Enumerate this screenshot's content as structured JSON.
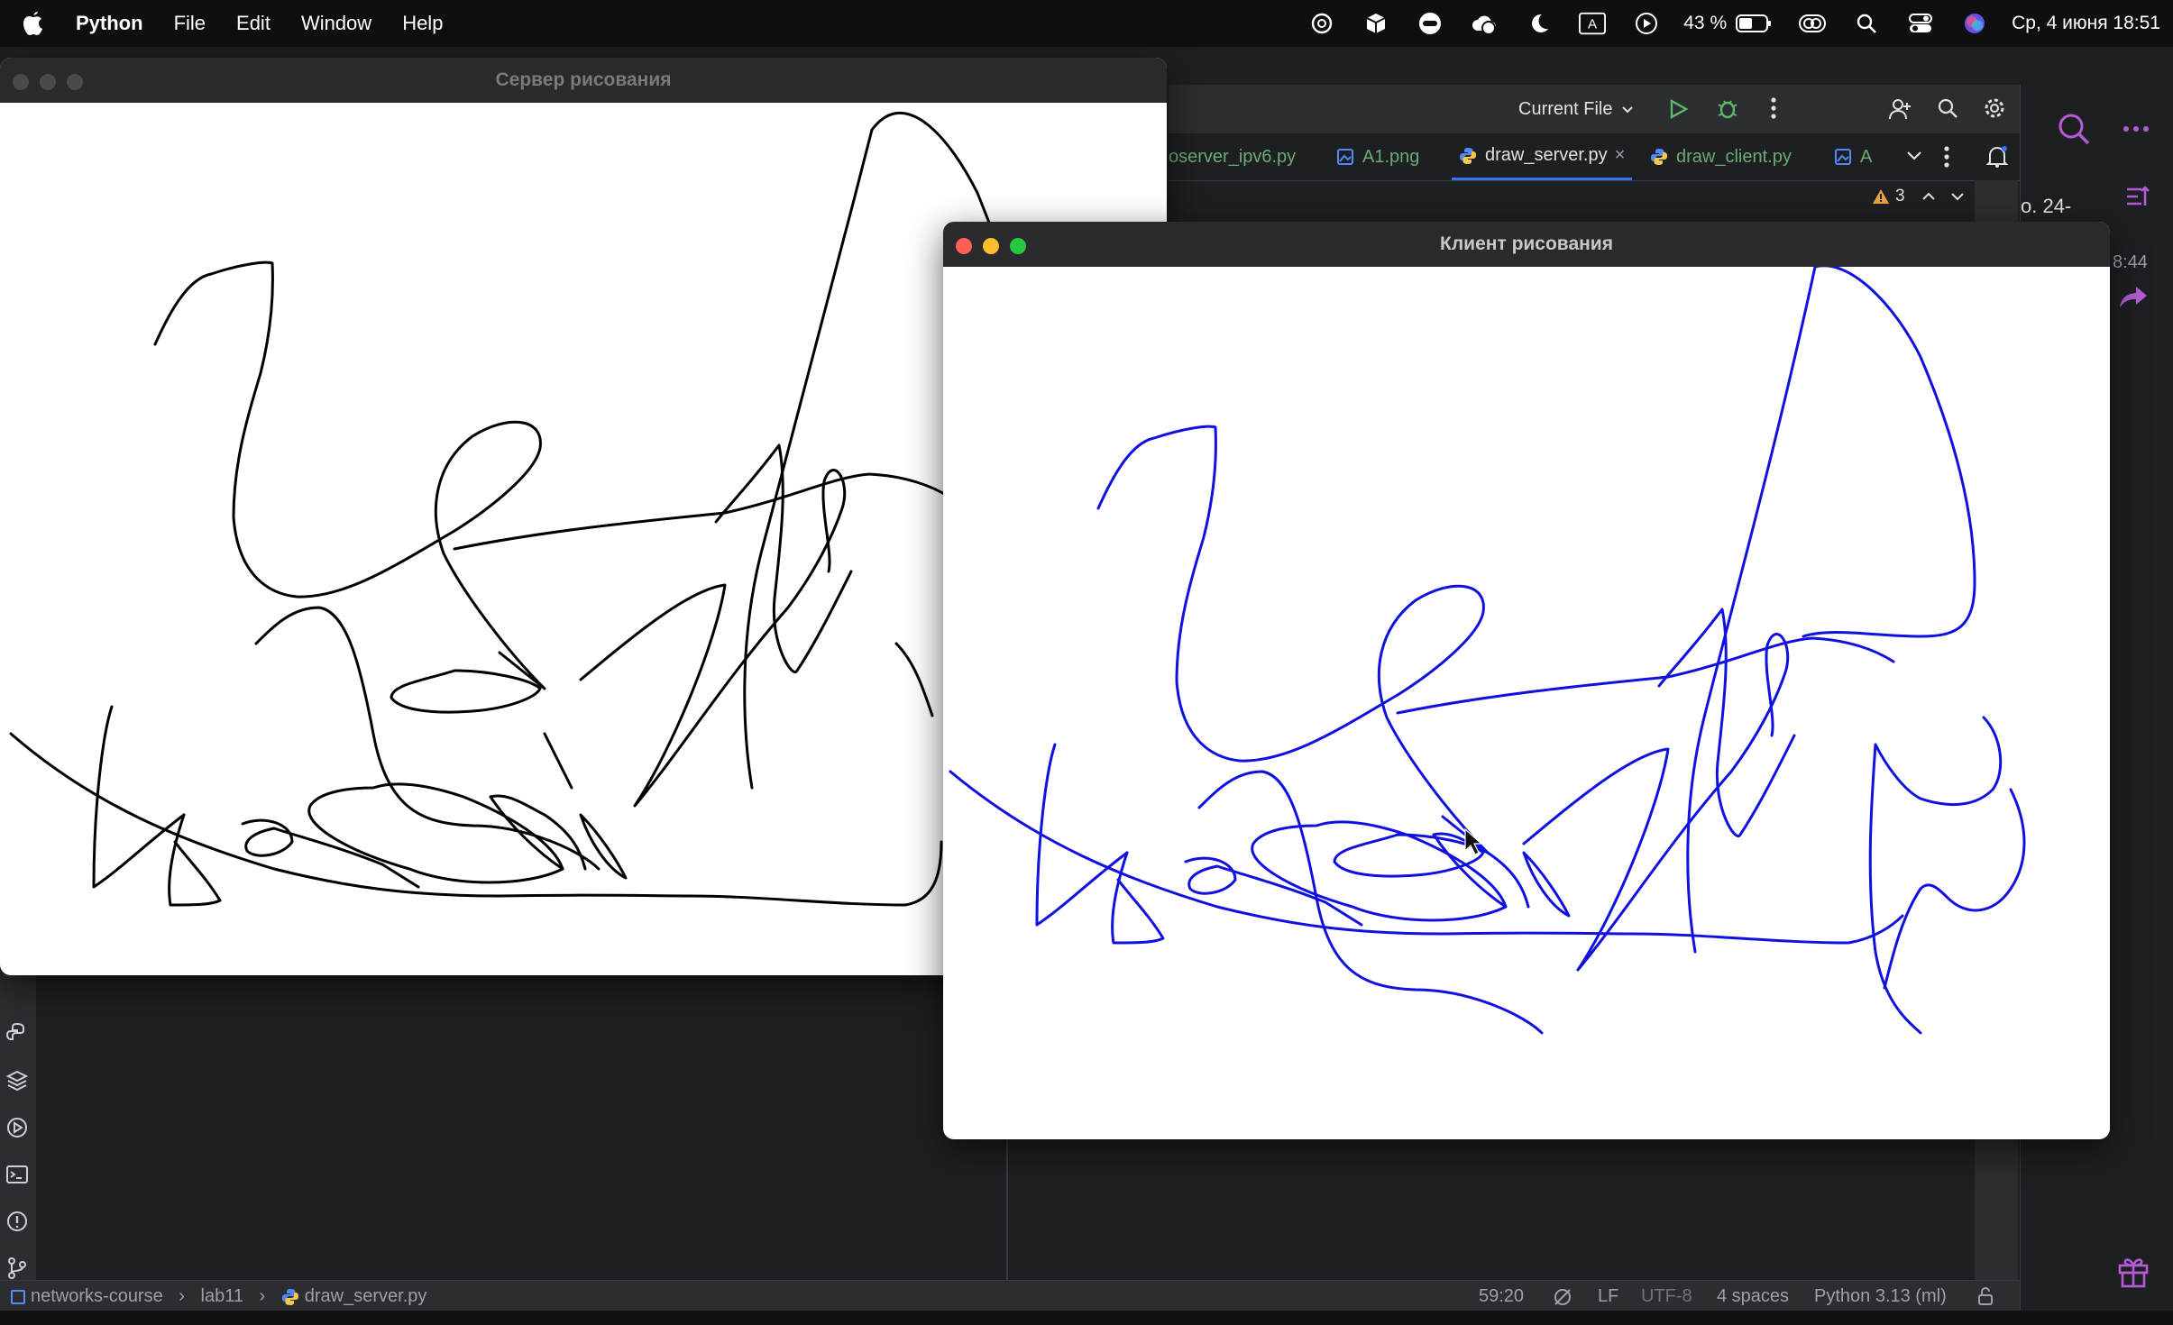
{
  "menubar": {
    "app_name": "Python",
    "menus": [
      "File",
      "Edit",
      "Window",
      "Help"
    ],
    "battery": "43 %",
    "input_source": "A",
    "date_time": "Ср, 4 июня  18:51"
  },
  "ide": {
    "run_config": "Current File",
    "tabs": [
      "oserver_ipv6.py",
      "A1.png",
      "draw_server.py",
      "draw_client.py",
      "A"
    ],
    "warnings_count": "3",
    "right_panel_text_1": "о.  24-",
    "right_panel_text_2": "8:44",
    "breadcrumb": [
      "networks-course",
      "lab11",
      "draw_server.py"
    ],
    "status": {
      "position": "59:20",
      "line_sep": "LF",
      "encoding": "UTF-8",
      "indent": "4 spaces",
      "interpreter": "Python 3.13 (ml)"
    }
  },
  "server_window": {
    "title": "Сервер рисования",
    "stroke_color": "#000000"
  },
  "client_window": {
    "title": "Клиент рисования",
    "stroke_color": "#1010e0"
  },
  "colors": {
    "accent": "#3574f0",
    "run_green": "#5fb865",
    "ai_purple": "#b45cd6"
  }
}
